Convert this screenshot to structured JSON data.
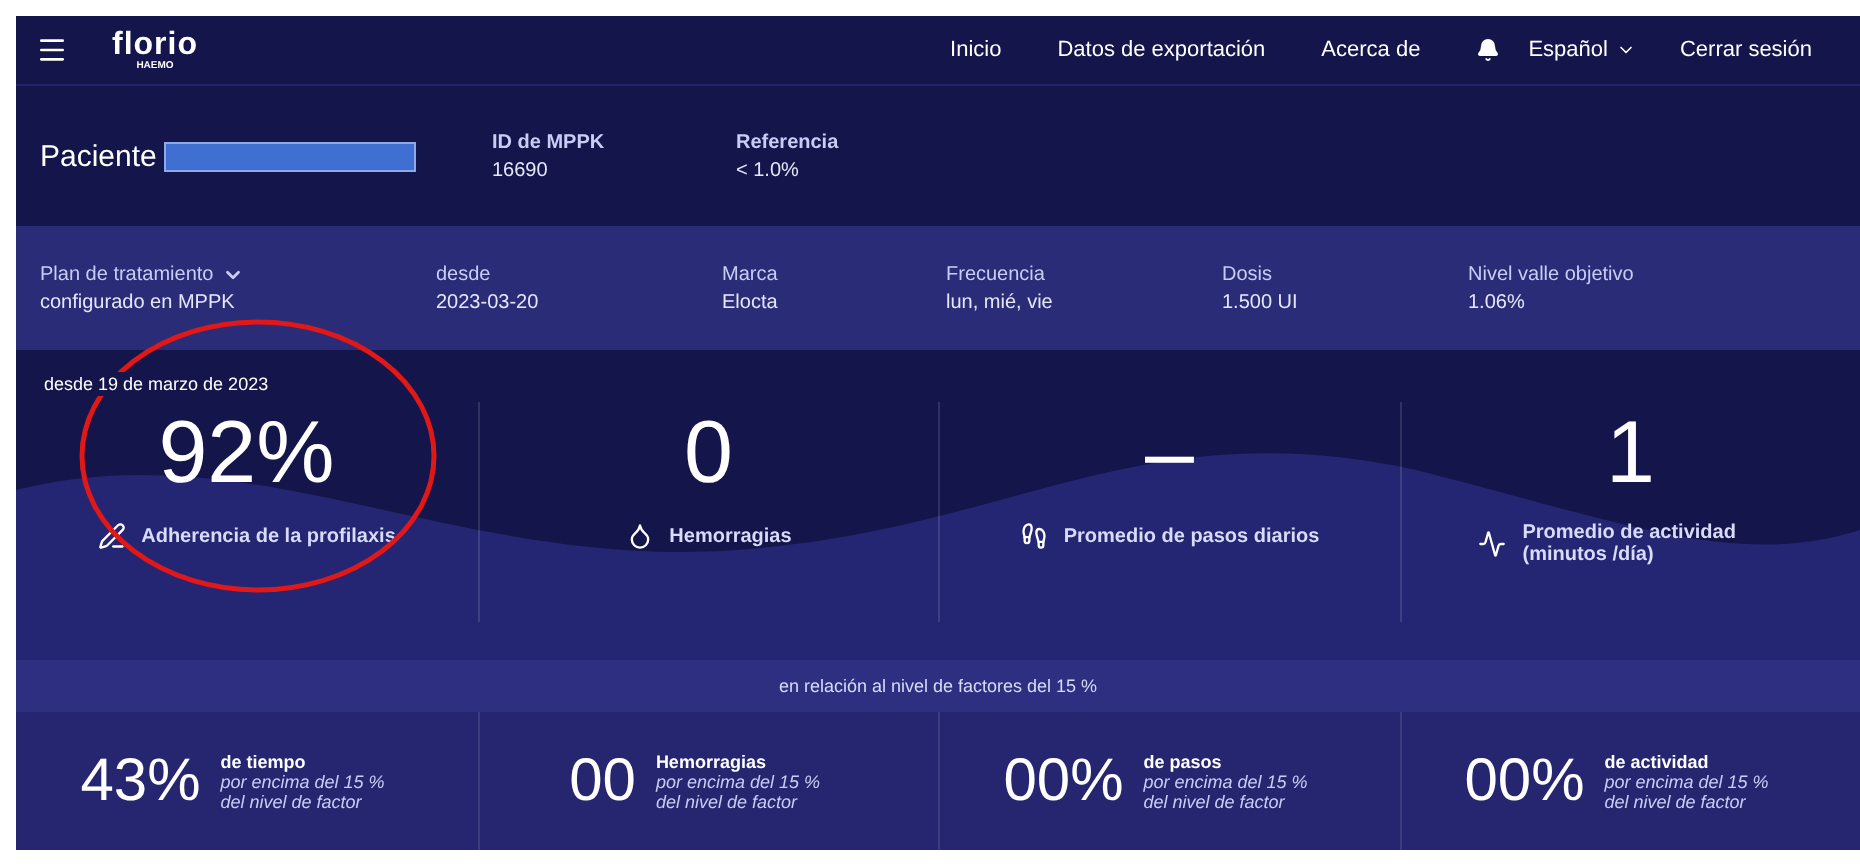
{
  "nav": {
    "logo": "florio",
    "logo_sub": "HAEMO",
    "links": [
      "Inicio",
      "Datos de exportación",
      "Acerca de"
    ],
    "language": "Español",
    "logout": "Cerrar sesión"
  },
  "patient": {
    "label": "Paciente",
    "fields": [
      {
        "label": "ID de MPPK",
        "value": "16690"
      },
      {
        "label": "Referencia",
        "value": "< 1.0%"
      }
    ]
  },
  "plan": [
    {
      "label": "Plan de tratamiento",
      "value": "configurado en MPPK",
      "kind": "dropdown"
    },
    {
      "label": "desde",
      "value": "2023-03-20",
      "kind": "plain"
    },
    {
      "label": "Marca",
      "value": "Elocta",
      "kind": "plain"
    },
    {
      "label": "Frecuencia",
      "value": "lun, mié, vie",
      "kind": "plain"
    },
    {
      "label": "Dosis",
      "value": "1.500 UI",
      "kind": "plain"
    },
    {
      "label": "Nivel valle objetivo",
      "value": "1.06%",
      "kind": "plain"
    }
  ],
  "stats": {
    "since": "desde 19 de marzo de 2023",
    "items": [
      {
        "value": "92%",
        "label": "Adherencia de la profilaxis"
      },
      {
        "value": "0",
        "label": "Hemorragias"
      },
      {
        "value": "–",
        "label": "Promedio de pasos diarios"
      },
      {
        "value": "1",
        "label": "Promedio de actividad (minutos /día)"
      }
    ]
  },
  "factors": {
    "caption": "en relación al nivel de factores del 15 %",
    "items": [
      {
        "value": "43%",
        "title": "de tiempo",
        "note": "por encima del 15 % del nivel de factor"
      },
      {
        "value": "00",
        "title": "Hemorragias",
        "note": "por encima del 15 % del nivel de factor"
      },
      {
        "value": "00%",
        "title": "de pasos",
        "note": "por encima del 15 % del nivel de factor"
      },
      {
        "value": "00%",
        "title": "de actividad",
        "note": "por encima del 15 % del nivel de factor"
      }
    ]
  }
}
